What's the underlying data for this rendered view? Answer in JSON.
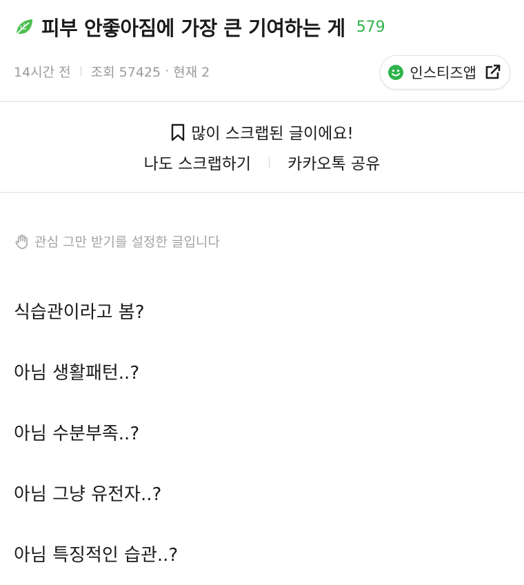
{
  "post": {
    "title": "피부 안좋아짐에 가장 큰 기여하는 게",
    "comment_count": "579",
    "time_ago": "14시간 전",
    "views": "조회 57425",
    "current": "현재 2",
    "meta_dot": "·",
    "icon_names": {
      "category": "leaf-icon",
      "app": "smile-icon",
      "open": "external-link-icon"
    }
  },
  "app_button": {
    "label": "인스티즈앱"
  },
  "scrap": {
    "notice": "많이 스크랩된 글이에요!",
    "scrap_label": "나도 스크랩하기",
    "share_label": "카카오톡 공유"
  },
  "notice": {
    "text": "관심 그만 받기를 설정한 글입니다"
  },
  "body": {
    "lines": [
      "식습관이라고 봄?",
      "아님 생활패턴..?",
      "아님 수분부족..?",
      "아님 그냥 유전자..?",
      "아님 특징적인 습관..?"
    ]
  },
  "colors": {
    "accent_green": "#2fb34a",
    "meta_gray": "#9a9a9a",
    "divider": "#ececec"
  }
}
